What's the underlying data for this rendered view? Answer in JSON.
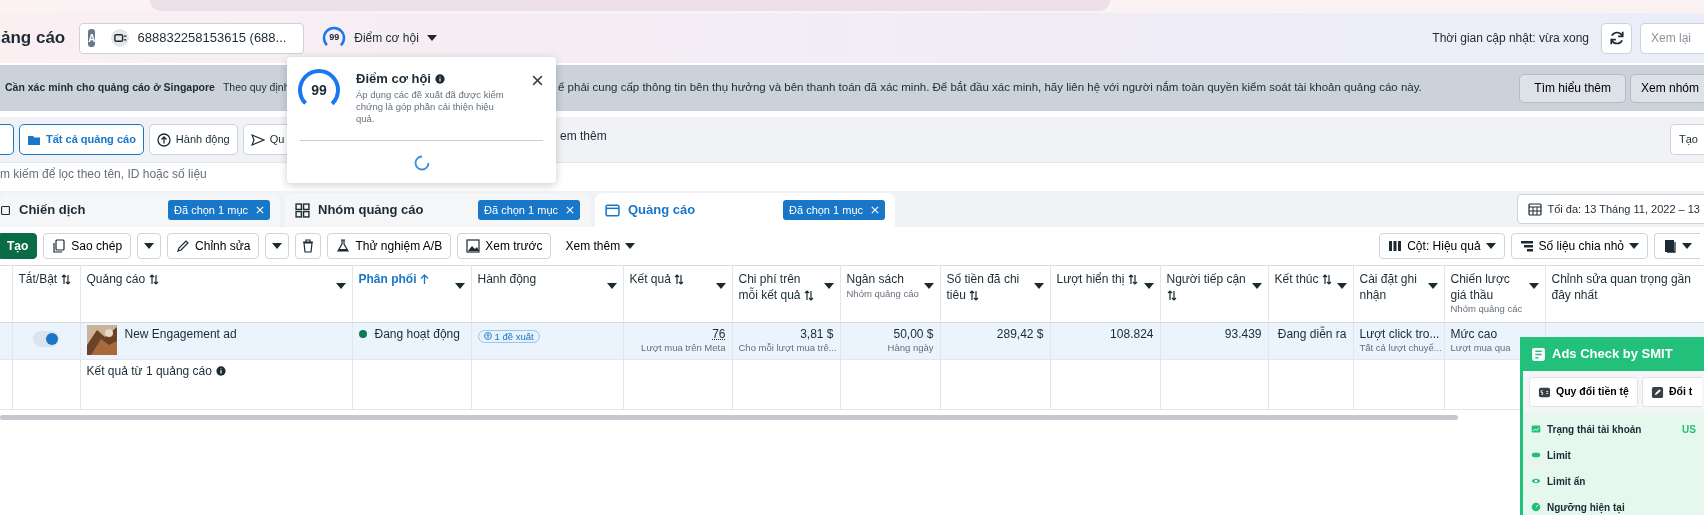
{
  "header": {
    "title": "ảng cáo",
    "account": {
      "avatar": "A",
      "label": "688832258153615 (688..."
    },
    "score": {
      "value": "99",
      "label": "Điểm cơ hội"
    },
    "updated": "Thời gian cập nhật: vừa xong",
    "review_button": "Xem lại"
  },
  "banner": {
    "title": "Cần xác minh cho quảng cáo ở Singapore",
    "text_before": "Theo quy định",
    "text_after": "ể phải cung cấp thông tin bên thụ hưởng và bên thanh toán đã xác minh. Để bắt đầu xác minh, hãy liên hệ với người nắm toàn quyền kiểm soát tài khoản quảng cáo này.",
    "buttons": [
      "Tìm hiểu thêm",
      "Xem nhóm"
    ]
  },
  "toolbar": {
    "buttons": [
      {
        "label": "Tất cả quảng cáo",
        "kind": "folder",
        "selected": true
      },
      {
        "label": "Hành động",
        "kind": "upload",
        "selected": false
      },
      {
        "label": "Qu",
        "kind": "send",
        "selected": false
      }
    ],
    "more": "em thêm",
    "create": "Tạo"
  },
  "search": {
    "placeholder": "m kiếm để lọc theo tên, ID hoặc số liệu"
  },
  "level_tabs": [
    {
      "label": "Chiến dịch",
      "kind": "campaign",
      "badge": "Đã chọn 1 mục",
      "selected": false
    },
    {
      "label": "Nhóm quảng cáo",
      "kind": "adset",
      "badge": "Đã chọn 1 mục",
      "selected": false
    },
    {
      "label": "Quảng cáo",
      "kind": "ad",
      "badge": "Đã chọn 1 mục",
      "selected": true
    }
  ],
  "date_range": "Tối đa: 13 Tháng 11, 2022 – 13",
  "actions": [
    {
      "kind": "create",
      "label": "Tạo"
    },
    {
      "kind": "copy",
      "label": "Sao chép"
    },
    {
      "kind": "edit",
      "label": "Chỉnh sửa"
    },
    {
      "kind": "delete"
    },
    {
      "kind": "abtest",
      "label": "Thử nghiệm A/B"
    },
    {
      "kind": "preview",
      "label": "Xem trước"
    },
    {
      "kind": "menu",
      "label": "Xem thêm"
    }
  ],
  "view_controls": [
    {
      "kind": "columns",
      "label": "Cột: Hiệu quả"
    },
    {
      "kind": "breakdown",
      "label": "Số liệu chia nhỏ"
    },
    {
      "kind": "report"
    }
  ],
  "table": {
    "columns": [
      {
        "label": "Tắt/Bật",
        "sortable": true,
        "sorted": false,
        "menu": false
      },
      {
        "label": "Quảng cáo",
        "sortable": true,
        "sorted": false,
        "menu": true
      },
      {
        "label": "Phân phối",
        "sortable": false,
        "sorted": true,
        "menu": true
      },
      {
        "label": "Hành động",
        "sortable": false,
        "sorted": false,
        "menu": true
      },
      {
        "label": "Kết quả",
        "sortable": true,
        "sorted": false,
        "menu": true
      },
      {
        "label": "Chi phí trên mỗi kết quả",
        "sortable": true,
        "sorted": false,
        "menu": true
      },
      {
        "label": "Ngân sách",
        "sub": "Nhóm quảng cáo",
        "sortable": false,
        "sorted": false,
        "menu": true
      },
      {
        "label": "Số tiền đã chi tiêu",
        "sortable": true,
        "sorted": false,
        "menu": true
      },
      {
        "label": "Lượt hiển thị",
        "sortable": true,
        "sorted": false,
        "menu": true
      },
      {
        "label": "Người tiếp cận",
        "sortable": true,
        "sorted": false,
        "menu": true
      },
      {
        "label": "Kết thúc",
        "sortable": true,
        "sorted": false,
        "menu": true
      },
      {
        "label": "Cài đặt ghi nhận",
        "sortable": false,
        "sorted": false,
        "menu": true
      },
      {
        "label": "Chiến lược giá thầu",
        "sub": "Nhóm quảng các",
        "sortable": false,
        "sorted": false,
        "menu": true
      },
      {
        "label": "Chỉnh sửa quan trọng gần đây nhất",
        "sortable": false,
        "sorted": false,
        "menu": false
      }
    ],
    "rows": [
      {
        "selected": true,
        "cells": [
          {
            "kind": "toggle",
            "on": true
          },
          {
            "kind": "name",
            "text": "New Engagement ad"
          },
          {
            "kind": "status",
            "text": "Đang hoạt động",
            "color": "#0b7a53"
          },
          {
            "kind": "badge",
            "text": "1 đề xuất"
          },
          {
            "kind": "link",
            "text": "76",
            "sub": "Lượt mua trên Meta"
          },
          {
            "kind": "number",
            "text": "3,81 $",
            "sub": "Cho mỗi lượt mua trê..."
          },
          {
            "kind": "number",
            "text": "50,00 $",
            "sub": "Hàng ngày"
          },
          {
            "kind": "number",
            "text": "289,42 $"
          },
          {
            "kind": "number",
            "text": "108.824"
          },
          {
            "kind": "number",
            "text": "93.439"
          },
          {
            "kind": "number",
            "text": "Đang diễn ra"
          },
          {
            "kind": "text",
            "text": "Lượt click tro...",
            "sub": "Tất cả lượt chuyể..."
          },
          {
            "kind": "text",
            "text": "Mức cao",
            "sub": "Lượt mua qua"
          }
        ]
      }
    ],
    "summary": "Kết quả từ 1 quảng cáo"
  },
  "popover": {
    "score": "99",
    "title": "Điểm cơ hội",
    "description": "Áp dụng các đề xuất đã được kiểm chứng là góp phần cải thiện hiệu quả."
  },
  "smit": {
    "title": "Ads Check by SMIT",
    "buttons": [
      "Quy đổi tiền tệ",
      "Đổi t"
    ],
    "items": [
      {
        "label": "Trạng thái tài khoản",
        "value": "US"
      },
      {
        "label": "Limit"
      },
      {
        "label": "Limit ẩn"
      },
      {
        "label": "Ngưỡng hiện tại"
      }
    ]
  }
}
